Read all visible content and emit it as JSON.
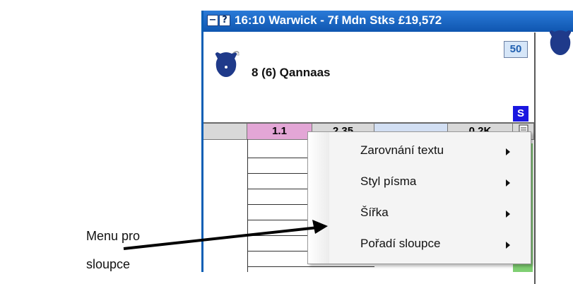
{
  "window": {
    "title": "16:10 Warwick - 7f Mdn Stks  £19,572",
    "minimize_glyph": "−",
    "help_glyph": "?"
  },
  "runner": {
    "label": "8  (6) Qannaas",
    "rating": "50",
    "status": "S"
  },
  "columns": {
    "headers": [
      "1.1",
      "2.35",
      "",
      "0.2K"
    ]
  },
  "context_menu": {
    "items": [
      {
        "label": "Zarovnání textu"
      },
      {
        "label": "Styl písma"
      },
      {
        "label": "Šířka"
      },
      {
        "label": "Pořadí sloupce"
      }
    ]
  },
  "annotation": {
    "line1": "Menu pro",
    "line2": "sloupce"
  },
  "colors": {
    "title_bar": "#0f56b0",
    "rating_text": "#1f5fb0",
    "status_box": "#1a17e0",
    "header_pink": "#e3a6d6",
    "header_blue": "#d2dff3",
    "green_cell": "#7fcf72"
  }
}
